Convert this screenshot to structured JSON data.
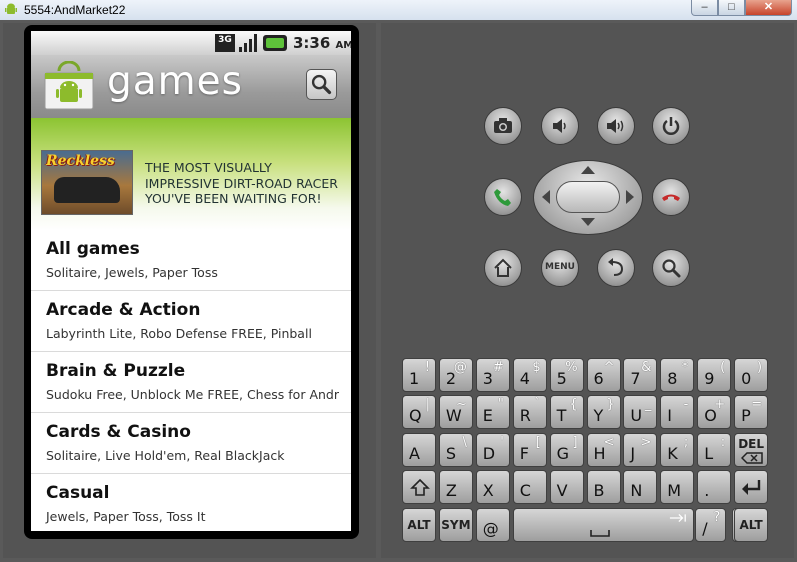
{
  "window": {
    "title": "5554:AndMarket22",
    "minimize": "–",
    "maximize": "□",
    "close": "✕"
  },
  "status_bar": {
    "network": "3G",
    "time": "3:36",
    "ampm": "AM"
  },
  "header": {
    "title": "games"
  },
  "banner": {
    "game_logo": "Reckless",
    "text": "THE MOST VISUALLY IMPRESSIVE DIRT-ROAD RACER YOU'VE BEEN WAITING FOR!"
  },
  "categories": [
    {
      "title": "All games",
      "subtitle": "Solitaire, Jewels, Paper Toss"
    },
    {
      "title": "Arcade & Action",
      "subtitle": "Labyrinth Lite, Robo Defense FREE, Pinball"
    },
    {
      "title": "Brain & Puzzle",
      "subtitle": "Sudoku Free, Unblock Me FREE, Chess for Andr"
    },
    {
      "title": "Cards & Casino",
      "subtitle": "Solitaire, Live Hold'em, Real BlackJack"
    },
    {
      "title": "Casual",
      "subtitle": "Jewels, Paper Toss, Toss It"
    }
  ],
  "hardware_buttons": {
    "menu": "MENU"
  },
  "keyboard": {
    "row1": [
      [
        "1",
        "!"
      ],
      [
        "2",
        "@"
      ],
      [
        "3",
        "#"
      ],
      [
        "4",
        "$"
      ],
      [
        "5",
        "%"
      ],
      [
        "6",
        "^"
      ],
      [
        "7",
        "&"
      ],
      [
        "8",
        "*"
      ],
      [
        "9",
        "("
      ],
      [
        "0",
        ")"
      ]
    ],
    "row2": [
      [
        "Q",
        "|"
      ],
      [
        "W",
        "~"
      ],
      [
        "E",
        "\""
      ],
      [
        "R",
        "`"
      ],
      [
        "T",
        "{"
      ],
      [
        "Y",
        "}"
      ],
      [
        "U",
        "_"
      ],
      [
        "I",
        "-"
      ],
      [
        "O",
        "+"
      ],
      [
        "P",
        "="
      ]
    ],
    "row3": [
      [
        "A",
        ""
      ],
      [
        "S",
        "\\"
      ],
      [
        "D",
        "'"
      ],
      [
        "F",
        "["
      ],
      [
        "G",
        "]"
      ],
      [
        "H",
        "<"
      ],
      [
        "J",
        ">"
      ],
      [
        "K",
        ";"
      ],
      [
        "L",
        ":"
      ]
    ],
    "row4": [
      [
        "Z",
        ""
      ],
      [
        "X",
        ""
      ],
      [
        "C",
        ""
      ],
      [
        "V",
        ""
      ],
      [
        "B",
        ""
      ],
      [
        "N",
        ""
      ],
      [
        "M",
        ""
      ],
      [
        ".",
        ""
      ]
    ],
    "del": "DEL",
    "alt": "ALT",
    "sym": "SYM",
    "at": "@",
    "slash": "/",
    "question": "?",
    "comma": ","
  }
}
